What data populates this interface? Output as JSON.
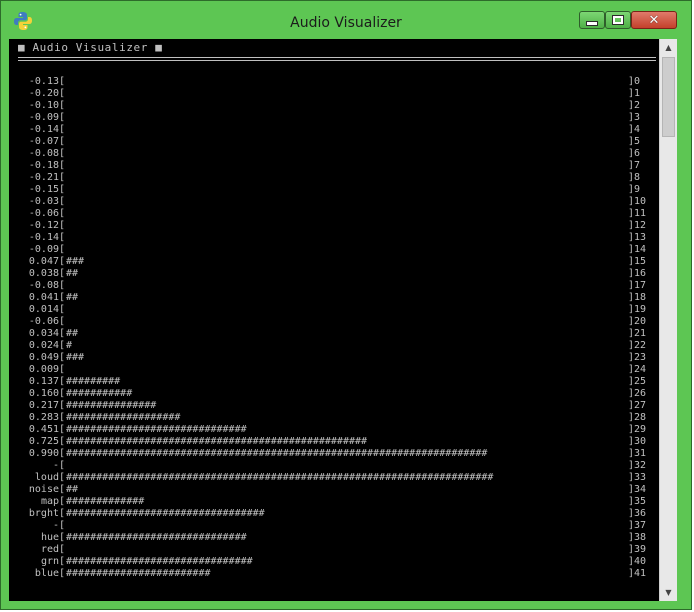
{
  "window": {
    "title": "Audio Visualizer",
    "icon": "python-icon",
    "controls": {
      "minimize": "minimize-icon",
      "maximize": "maximize-icon",
      "close": "✕"
    }
  },
  "console": {
    "header": "■ Audio Visualizer ■",
    "rows": [
      {
        "label": "-0.13",
        "bar": "",
        "index": "0"
      },
      {
        "label": "-0.20",
        "bar": "",
        "index": "1"
      },
      {
        "label": "-0.10",
        "bar": "",
        "index": "2"
      },
      {
        "label": "-0.09",
        "bar": "",
        "index": "3"
      },
      {
        "label": "-0.14",
        "bar": "",
        "index": "4"
      },
      {
        "label": "-0.07",
        "bar": "",
        "index": "5"
      },
      {
        "label": "-0.08",
        "bar": "",
        "index": "6"
      },
      {
        "label": "-0.18",
        "bar": "",
        "index": "7"
      },
      {
        "label": "-0.21",
        "bar": "",
        "index": "8"
      },
      {
        "label": "-0.15",
        "bar": "",
        "index": "9"
      },
      {
        "label": "-0.03",
        "bar": "",
        "index": "10"
      },
      {
        "label": "-0.06",
        "bar": "",
        "index": "11"
      },
      {
        "label": "-0.12",
        "bar": "",
        "index": "12"
      },
      {
        "label": "-0.14",
        "bar": "",
        "index": "13"
      },
      {
        "label": "-0.09",
        "bar": "",
        "index": "14"
      },
      {
        "label": "0.047",
        "bar": "###",
        "index": "15"
      },
      {
        "label": "0.038",
        "bar": "##",
        "index": "16"
      },
      {
        "label": "-0.08",
        "bar": "",
        "index": "17"
      },
      {
        "label": "0.041",
        "bar": "##",
        "index": "18"
      },
      {
        "label": "0.014",
        "bar": "",
        "index": "19"
      },
      {
        "label": "-0.06",
        "bar": "",
        "index": "20"
      },
      {
        "label": "0.034",
        "bar": "##",
        "index": "21"
      },
      {
        "label": "0.024",
        "bar": "#",
        "index": "22"
      },
      {
        "label": "0.049",
        "bar": "###",
        "index": "23"
      },
      {
        "label": "0.009",
        "bar": "",
        "index": "24"
      },
      {
        "label": "0.137",
        "bar": "#########",
        "index": "25"
      },
      {
        "label": "0.160",
        "bar": "###########",
        "index": "26"
      },
      {
        "label": "0.217",
        "bar": "###############",
        "index": "27"
      },
      {
        "label": "0.283",
        "bar": "###################",
        "index": "28"
      },
      {
        "label": "0.451",
        "bar": "##############################",
        "index": "29"
      },
      {
        "label": "0.725",
        "bar": "##################################################",
        "index": "30"
      },
      {
        "label": "0.990",
        "bar": "######################################################################",
        "index": "31"
      },
      {
        "label": "-",
        "bar": "",
        "index": "32"
      },
      {
        "label": "loud",
        "bar": "#######################################################################",
        "index": "33"
      },
      {
        "label": "noise",
        "bar": "##",
        "index": "34"
      },
      {
        "label": "map",
        "bar": "#############",
        "index": "35"
      },
      {
        "label": "brght",
        "bar": "#################################",
        "index": "36"
      },
      {
        "label": "-",
        "bar": "",
        "index": "37"
      },
      {
        "label": "hue",
        "bar": "##############################",
        "index": "38"
      },
      {
        "label": "red",
        "bar": "",
        "index": "39"
      },
      {
        "label": "grn",
        "bar": "###############################",
        "index": "40"
      },
      {
        "label": "blue",
        "bar": "########################",
        "index": "41"
      }
    ]
  },
  "colors": {
    "frame": "#5dc653",
    "console_bg": "#000000",
    "console_text": "#c0c0c0",
    "close_button": "#c4402b"
  }
}
